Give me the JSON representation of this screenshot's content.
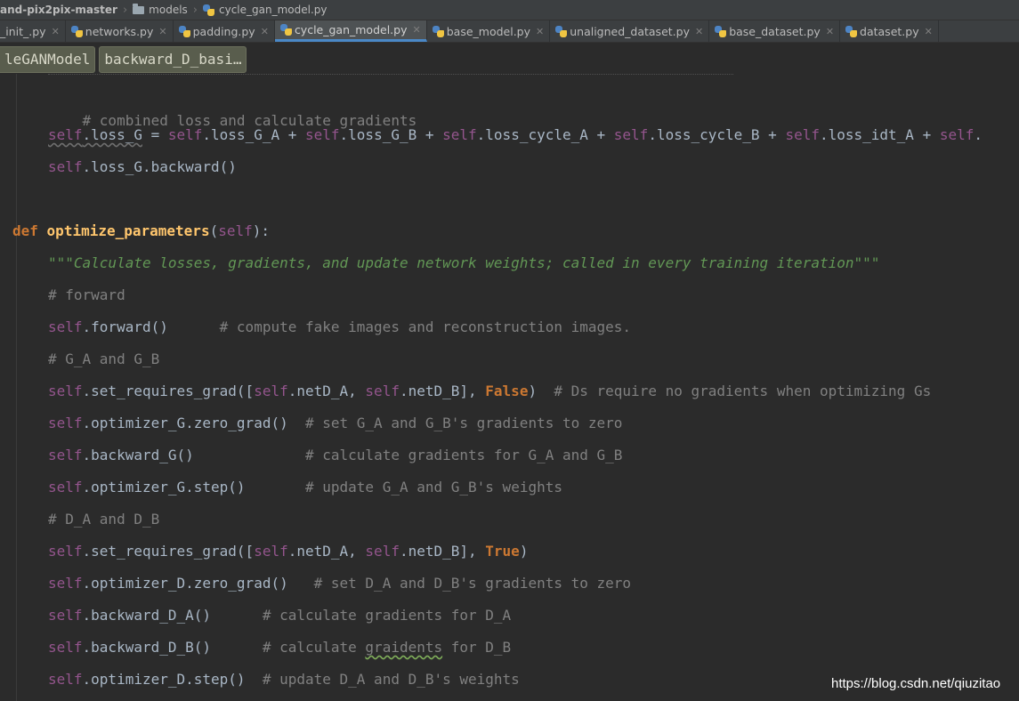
{
  "breadcrumb": {
    "items": [
      "and-pix2pix-master",
      "models",
      "cycle_gan_model.py"
    ]
  },
  "tabs": [
    {
      "label": "_init_.py",
      "active": false
    },
    {
      "label": "networks.py",
      "active": false
    },
    {
      "label": "padding.py",
      "active": false
    },
    {
      "label": "cycle_gan_model.py",
      "active": true
    },
    {
      "label": "base_model.py",
      "active": false
    },
    {
      "label": "unaligned_dataset.py",
      "active": false
    },
    {
      "label": "base_dataset.py",
      "active": false
    },
    {
      "label": "dataset.py",
      "active": false
    }
  ],
  "structure": {
    "class_label": "leGANModel",
    "method_label": "backward_D_basi…"
  },
  "code": {
    "comment_combined": "# combined loss and calculate gradients",
    "loss_g_line": {
      "self1": "self",
      "lhs": ".loss_G",
      "op1": " = ",
      "self2": "self",
      "t2": ".loss_G_A + ",
      "self3": "self",
      "t3": ".loss_G_B + ",
      "self4": "self",
      "t4": ".loss_cycle_A + ",
      "self5": "self",
      "t5": ".loss_cycle_B + ",
      "self6": "self",
      "t6": ".loss_idt_A + ",
      "self7": "self",
      "t7": "."
    },
    "backward_line": {
      "self": "self",
      "text": ".loss_G.backward()"
    },
    "def_line": {
      "kw": "def",
      "name": "optimize_parameters",
      "open": "(",
      "param": "self",
      "close": "):"
    },
    "docstring": "\"\"\"Calculate losses, gradients, and update network weights; called in every training iteration\"\"\"",
    "comment_forward": "# forward",
    "forward_line": {
      "self": "self",
      "call": ".forward()",
      "pad": "      ",
      "comment": "# compute fake images and reconstruction images."
    },
    "comment_ga_gb": "# G_A and G_B",
    "set_req_false": {
      "self1": "self",
      "t1": ".set_requires_grad([",
      "self2": "self",
      "t2": ".netD_A, ",
      "self3": "self",
      "t3": ".netD_B], ",
      "bool": "False",
      "t4": ")  ",
      "comment": "# Ds require no gradients when optimizing Gs"
    },
    "zero_grad_g": {
      "self": "self",
      "call": ".optimizer_G.zero_grad()",
      "pad": "  ",
      "comment": "# set G_A and G_B's gradients to zero"
    },
    "backward_g": {
      "self": "self",
      "call": ".backward_G()",
      "pad": "             ",
      "comment": "# calculate gradients for G_A and G_B"
    },
    "step_g": {
      "self": "self",
      "call": ".optimizer_G.step()",
      "pad": "       ",
      "comment": "# update G_A and G_B's weights"
    },
    "comment_da_db": "# D_A and D_B",
    "set_req_true": {
      "self1": "self",
      "t1": ".set_requires_grad([",
      "self2": "self",
      "t2": ".netD_A, ",
      "self3": "self",
      "t3": ".netD_B], ",
      "bool": "True",
      "t4": ")"
    },
    "zero_grad_d": {
      "self": "self",
      "call": ".optimizer_D.zero_grad()",
      "pad": "   ",
      "comment": "# set D_A and D_B's gradients to zero"
    },
    "backward_da": {
      "self": "self",
      "call": ".backward_D_A()",
      "pad": "      ",
      "comment": "# calculate gradients for D_A"
    },
    "backward_db": {
      "self": "self",
      "call": ".backward_D_B()",
      "pad": "      ",
      "comment_pre": "# calculate ",
      "comment_typo": "graidents",
      "comment_post": " for D_B"
    },
    "step_d": {
      "self": "self",
      "call": ".optimizer_D.step()",
      "pad": "  ",
      "comment": "# update D_A and D_B's weights"
    }
  },
  "watermark": "https://blog.csdn.net/qiuzitao"
}
